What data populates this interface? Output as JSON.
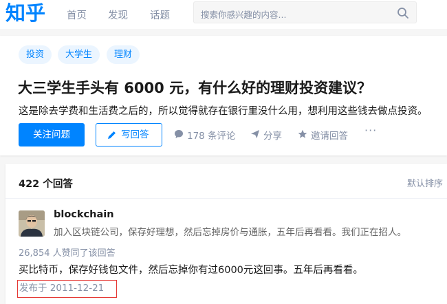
{
  "header": {
    "logo": "知乎",
    "nav": [
      "首页",
      "发现",
      "话题"
    ],
    "search_placeholder": "搜索你感兴趣的内容..."
  },
  "question": {
    "tags": [
      "投资",
      "大学生",
      "理财"
    ],
    "title": "大三学生手头有 6000 元，有什么好的理财投资建议？",
    "description": "这是除去学费和生活费之后的，所以觉得就存在银行里没什么用，想利用这些钱去做点投资。",
    "follow_label": "关注问题",
    "write_label": "写回答",
    "comment_label": "178 条评论",
    "share_label": "分享",
    "invite_label": "邀请回答",
    "more_label": "···"
  },
  "answers": {
    "count_label": "422 个回答",
    "sort_label": "默认排序",
    "items": [
      {
        "author": "blockchain",
        "headline": "加入区块链公司，保存好理想，然后忘掉房价与通胀，五年后再看看。我们正在招人。",
        "votes": "26,854 人赞同了该回答",
        "content": "买比特币，保存好钱包文件，然后忘掉你有过6000元这回事。五年后再看看。",
        "posted": "发布于 2011-12-21"
      }
    ]
  },
  "colors": {
    "brand": "#0084ff",
    "highlight_box": "#e53935"
  }
}
